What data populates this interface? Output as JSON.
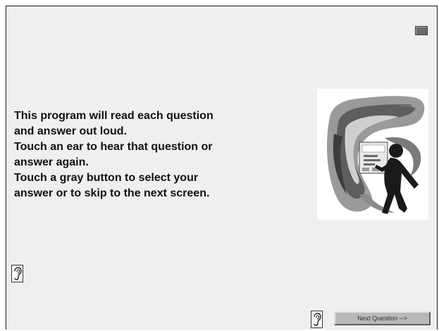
{
  "instructions": {
    "line1": "This program will read each question",
    "line2": "and answer out loud.",
    "line3": "Touch an ear to hear that question or",
    "line4": "answer again.",
    "line5": "Touch a gray button to select your",
    "line6": "answer or to skip to the next screen."
  },
  "illustration": {
    "label": "Touch-screen kiosk illustration"
  },
  "buttons": {
    "next_label": "Next Question -->",
    "ear_icon": "ear-icon",
    "window_icon": "window-icon"
  },
  "colors": {
    "background": "#efefef",
    "button_gray": "#b9b9b9",
    "border": "#1a1a1a"
  }
}
